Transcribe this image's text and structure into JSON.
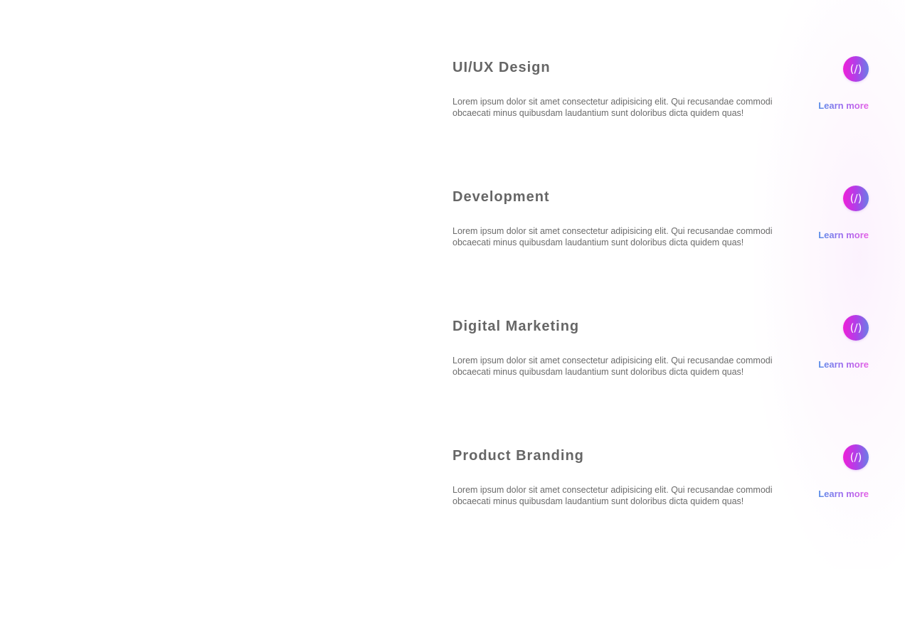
{
  "services": {
    "icon": "code-icon",
    "icon_glyph": "(/)",
    "accent_gradient": [
      "#f01fd8",
      "#b13ee8",
      "#6a7fe6"
    ],
    "link_gradient": [
      "#5b8fe8",
      "#9b6cef",
      "#e85fe6"
    ],
    "items": [
      {
        "title": "UI/UX Design",
        "text": "Lorem ipsum dolor sit amet consectetur adipisicing elit. Qui recusandae commodi obcaecati minus quibusdam laudantium sunt doloribus dicta quidem quas!",
        "link": "Learn more"
      },
      {
        "title": "Development",
        "text": "Lorem ipsum dolor sit amet consectetur adipisicing elit. Qui recusandae commodi obcaecati minus quibusdam laudantium sunt doloribus dicta quidem quas!",
        "link": "Learn more"
      },
      {
        "title": "Digital Marketing",
        "text": "Lorem ipsum dolor sit amet consectetur adipisicing elit. Qui recusandae commodi obcaecati minus quibusdam laudantium sunt doloribus dicta quidem quas!",
        "link": "Learn more"
      },
      {
        "title": "Product Branding",
        "text": "Lorem ipsum dolor sit amet consectetur adipisicing elit. Qui recusandae commodi obcaecati minus quibusdam laudantium sunt doloribus dicta quidem quas!",
        "link": "Learn more"
      }
    ]
  }
}
